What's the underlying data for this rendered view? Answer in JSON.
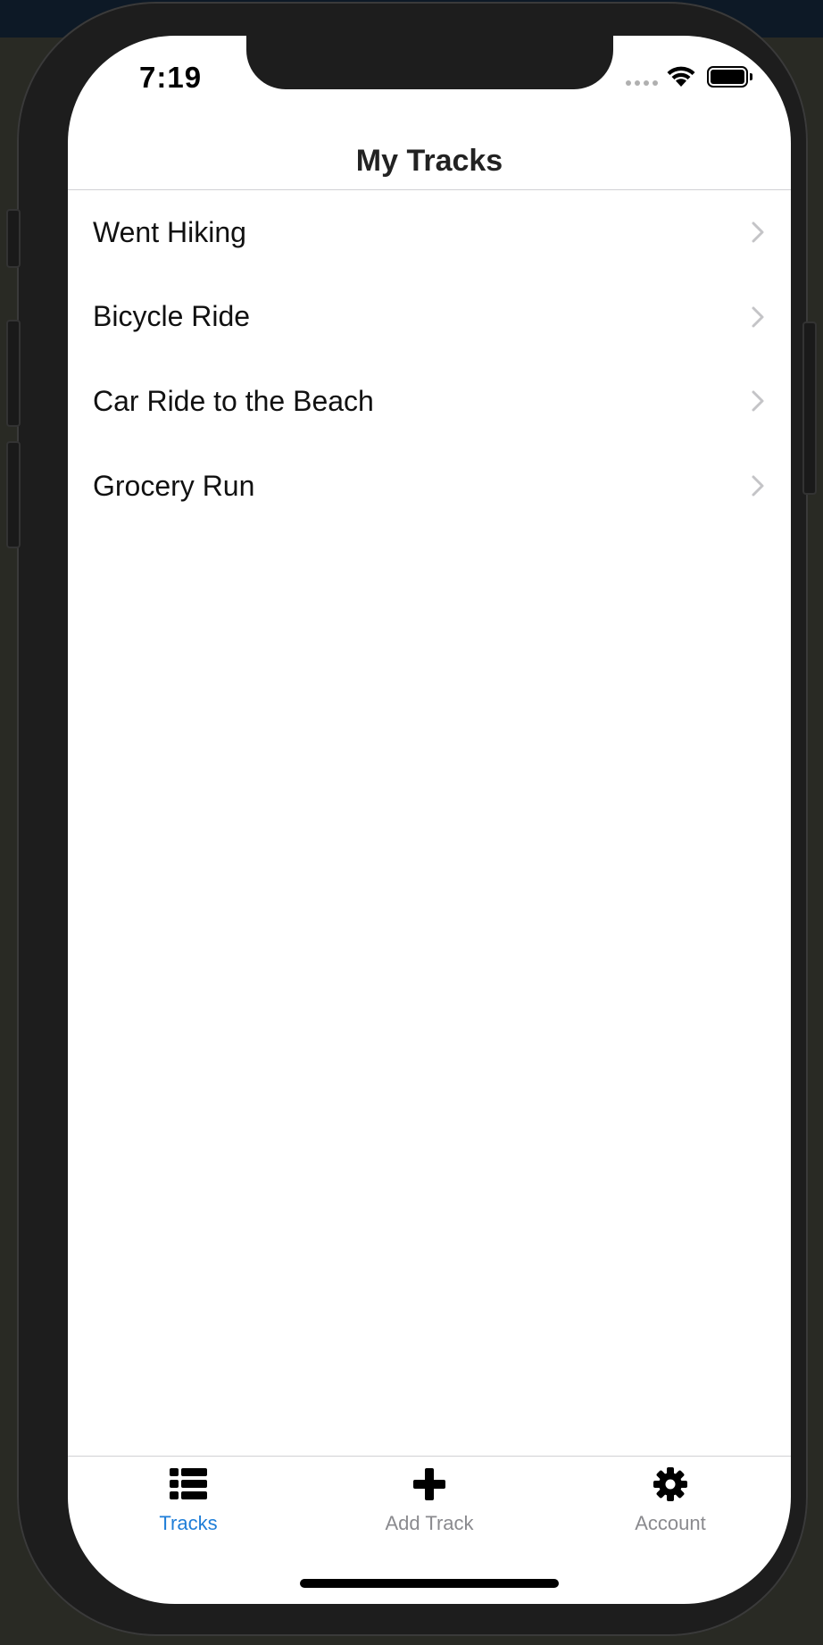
{
  "status_bar": {
    "time": "7:19"
  },
  "nav": {
    "title": "My Tracks"
  },
  "tracks": [
    {
      "label": "Went Hiking"
    },
    {
      "label": "Bicycle Ride"
    },
    {
      "label": "Car Ride to the Beach"
    },
    {
      "label": "Grocery Run"
    }
  ],
  "tab_bar": {
    "tabs": [
      {
        "label": "Tracks",
        "icon": "list-icon",
        "active": true
      },
      {
        "label": "Add Track",
        "icon": "plus-icon",
        "active": false
      },
      {
        "label": "Account",
        "icon": "gear-icon",
        "active": false
      }
    ]
  },
  "colors": {
    "accent": "#1f7ed8",
    "inactive_tab": "#8a8a8e",
    "background": "#ffffff",
    "device_frame": "#1d1d1d"
  }
}
